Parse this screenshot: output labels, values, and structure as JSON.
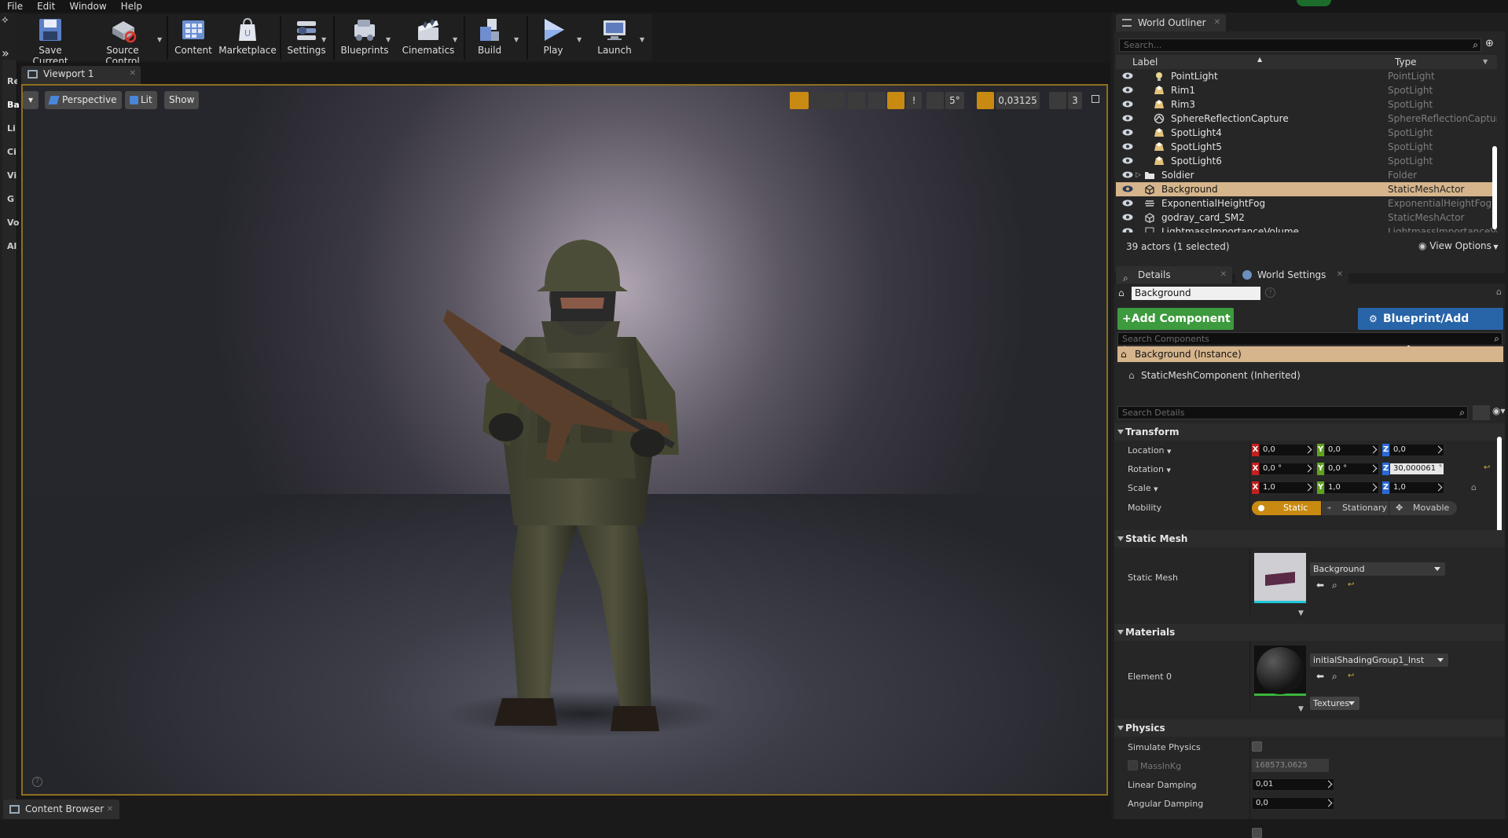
{
  "menu": [
    "File",
    "Edit",
    "Window",
    "Help"
  ],
  "toolbar": [
    {
      "label": "Save Current",
      "icon": "save-icon"
    },
    {
      "label": "Source Control",
      "icon": "source-control-icon"
    },
    {
      "label": "Content",
      "icon": "content-icon"
    },
    {
      "label": "Marketplace",
      "icon": "marketplace-icon"
    },
    {
      "label": "Settings",
      "icon": "settings-icon"
    },
    {
      "label": "Blueprints",
      "icon": "blueprints-icon"
    },
    {
      "label": "Cinematics",
      "icon": "cinematics-icon"
    },
    {
      "label": "Build",
      "icon": "build-icon"
    },
    {
      "label": "Play",
      "icon": "play-icon"
    },
    {
      "label": "Launch",
      "icon": "launch-icon"
    }
  ],
  "modes": [
    "Re",
    "Ba",
    "Li",
    "Ci",
    "Vi",
    "G",
    "Vo",
    "Al"
  ],
  "viewport": {
    "tab": "Viewport 1",
    "perspective": "Perspective",
    "lit": "Lit",
    "show": "Show",
    "angle_snap": "5°",
    "scale_snap": "0,03125",
    "cam_speed": "3"
  },
  "content_browser_tab": "Content Browser",
  "outliner": {
    "tab": "World Outliner",
    "search_placeholder": "Search...",
    "col_label": "Label",
    "col_type": "Type",
    "rows": [
      {
        "label": "PointLight",
        "type": "PointLight",
        "indent": 1,
        "icon": "point-light-icon"
      },
      {
        "label": "Rim1",
        "type": "SpotLight",
        "indent": 1,
        "icon": "spot-light-icon"
      },
      {
        "label": "Rim3",
        "type": "SpotLight",
        "indent": 1,
        "icon": "spot-light-icon"
      },
      {
        "label": "SphereReflectionCapture",
        "type": "SphereReflectionCaptur",
        "indent": 1,
        "icon": "reflection-capture-icon"
      },
      {
        "label": "SpotLight4",
        "type": "SpotLight",
        "indent": 1,
        "icon": "spot-light-icon"
      },
      {
        "label": "SpotLight5",
        "type": "SpotLight",
        "indent": 1,
        "icon": "spot-light-icon"
      },
      {
        "label": "SpotLight6",
        "type": "SpotLight",
        "indent": 1,
        "icon": "spot-light-icon"
      },
      {
        "label": "Soldier",
        "type": "Folder",
        "indent": 0,
        "icon": "folder-icon"
      },
      {
        "label": "Background",
        "type": "StaticMeshActor",
        "indent": 0,
        "icon": "static-mesh-icon",
        "selected": true
      },
      {
        "label": "ExponentialHeightFog",
        "type": "ExponentialHeightFog",
        "indent": 0,
        "icon": "fog-icon"
      },
      {
        "label": "godray_card_SM2",
        "type": "StaticMeshActor",
        "indent": 0,
        "icon": "static-mesh-icon"
      },
      {
        "label": "LightmassImportanceVolume",
        "type": "LightmassImportanceVo",
        "indent": 0,
        "icon": "volume-icon"
      }
    ],
    "status": "39 actors (1 selected)",
    "view_options": "View Options"
  },
  "details": {
    "tab": "Details",
    "tab2": "World Settings",
    "name": "Background",
    "add_component": "Add Component",
    "blueprint": "Blueprint/Add Script",
    "search_components": "Search Components",
    "instance": "Background (Instance)",
    "component": "StaticMeshComponent (Inherited)",
    "search_details": "Search Details",
    "transform": {
      "title": "Transform",
      "location_label": "Location",
      "rotation_label": "Rotation",
      "scale_label": "Scale",
      "mobility_label": "Mobility",
      "location": [
        "0,0",
        "0,0",
        "0,0"
      ],
      "rotation": [
        "0,0 °",
        "0,0 °",
        "30,000061 °"
      ],
      "scale": [
        "1,0",
        "1,0",
        "1,0"
      ],
      "mobility": [
        "Static",
        "Stationary",
        "Movable"
      ]
    },
    "static_mesh": {
      "title": "Static Mesh",
      "label": "Static Mesh",
      "value": "Background"
    },
    "materials": {
      "title": "Materials",
      "label": "Element 0",
      "value": "initialShadingGroup1_Inst",
      "textures": "Textures"
    },
    "physics": {
      "title": "Physics",
      "simulate": "Simulate Physics",
      "mass_label": "MassInKg",
      "mass": "168573,0625",
      "linear_label": "Linear Damping",
      "linear": "0,01",
      "angular_label": "Angular Damping",
      "angular": "0,0"
    }
  },
  "colors": {
    "accent": "#c98a12",
    "selection": "#d6b58c",
    "add_component": "#3d9a3d",
    "blueprint": "#2864a8"
  }
}
